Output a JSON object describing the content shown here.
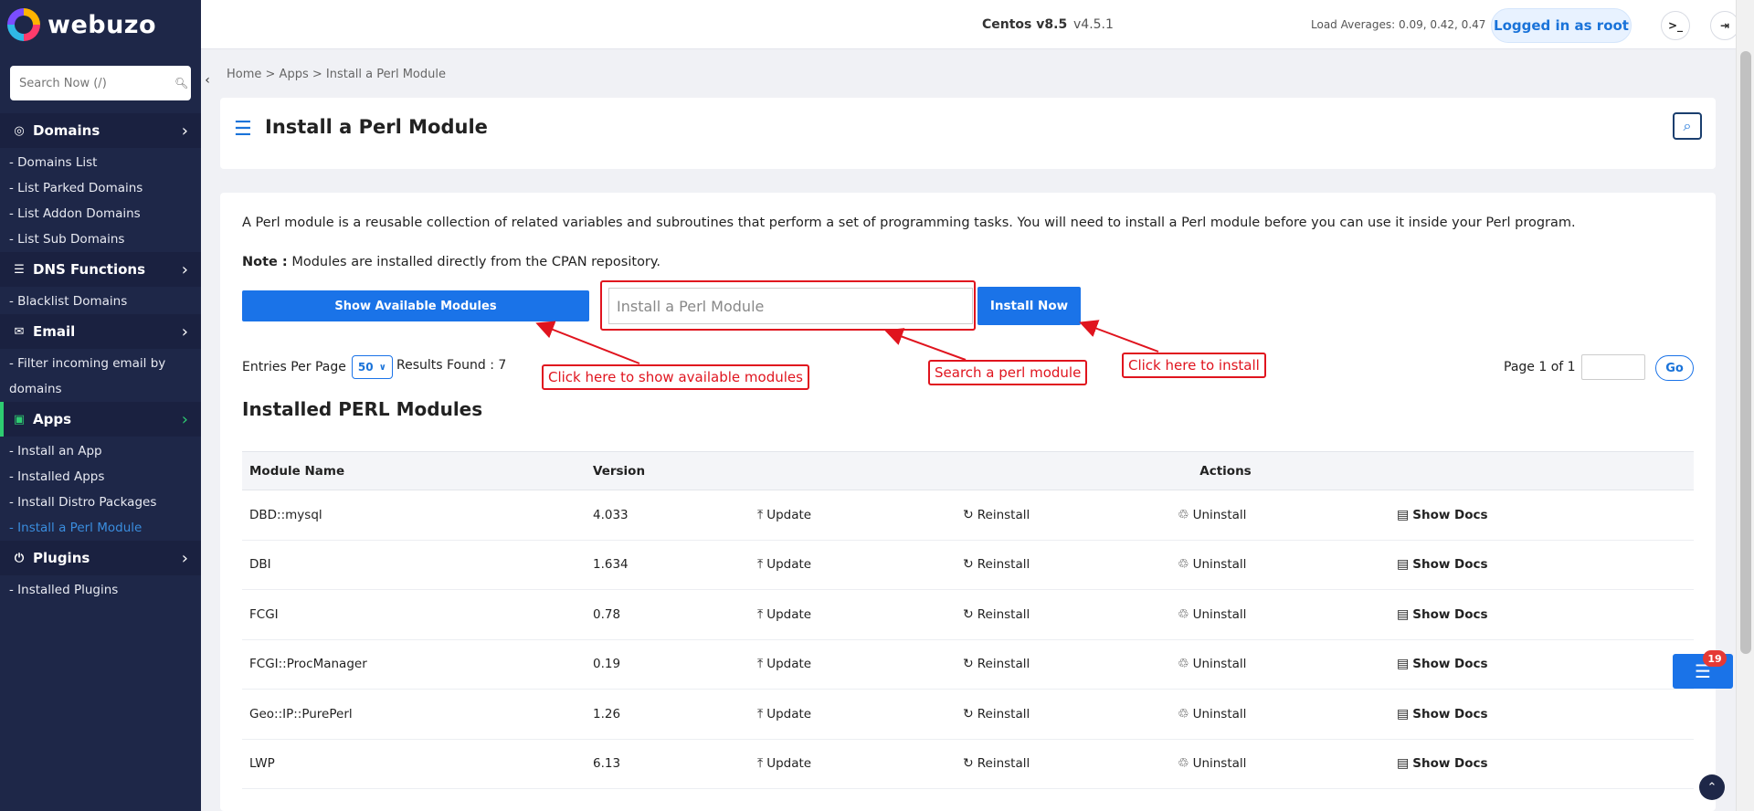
{
  "brand": {
    "name": "webuzo"
  },
  "sidebar": {
    "search_placeholder": "Search Now (/)",
    "collapse_icon": "chevron-left-icon",
    "sections": {
      "domains": {
        "title": "Domains",
        "items": [
          "- Domains List",
          "- List Parked Domains",
          "- List Addon Domains",
          "- List Sub Domains"
        ]
      },
      "dns": {
        "title": "DNS Functions",
        "items": [
          "- Blacklist Domains"
        ]
      },
      "email": {
        "title": "Email",
        "items": [
          "- Filter incoming email by",
          "domains"
        ]
      },
      "apps": {
        "title": "Apps",
        "items": [
          "- Install an App",
          "- Installed Apps",
          "- Install Distro Packages",
          "- Install a Perl Module"
        ]
      },
      "plugins": {
        "title": "Plugins",
        "items": [
          "- Installed Plugins"
        ]
      }
    }
  },
  "topbar": {
    "os_name": "Centos v8.5",
    "os_version": "v4.5.1",
    "load_averages": "Load Averages: 0.09, 0.42, 0.47",
    "logged_in_label": "Logged in as root"
  },
  "breadcrumb": "Home > Apps > Install a Perl Module",
  "page": {
    "title": "Install a Perl Module",
    "description": "A Perl module is a reusable collection of related variables and subroutines that perform a set of programming tasks. You will need to install a Perl module before you can use it inside your Perl program.",
    "note_label": "Note :",
    "note_text": " Modules are installed directly from the CPAN repository.",
    "show_modules_label": "Show Available Modules",
    "perl_input_placeholder": "Install a Perl Module",
    "install_now_label": "Install Now",
    "entries_label": "Entries Per Page",
    "entries_value": "50",
    "results_found": "Results Found : 7",
    "page_of": "Page 1 of 1",
    "go_label": "Go",
    "installed_title": "Installed PERL Modules"
  },
  "table": {
    "headers": {
      "name": "Module Name",
      "version": "Version",
      "actions": "Actions"
    },
    "action_labels": {
      "update": "Update",
      "reinstall": "Reinstall",
      "uninstall": "Uninstall",
      "docs": "Show Docs"
    },
    "rows": [
      {
        "name": "DBD::mysql",
        "version": "4.033"
      },
      {
        "name": "DBI",
        "version": "1.634"
      },
      {
        "name": "FCGI",
        "version": "0.78"
      },
      {
        "name": "FCGI::ProcManager",
        "version": "0.19"
      },
      {
        "name": "Geo::IP::PurePerl",
        "version": "1.26"
      },
      {
        "name": "LWP",
        "version": "6.13"
      }
    ]
  },
  "annotations": {
    "show_modules": "Click here to show available modules",
    "search_module": "Search a perl module",
    "install": "Click here to install"
  },
  "floating": {
    "badge_count": "19"
  },
  "colors": {
    "sidebar_bg": "#1e2748",
    "primary": "#1a73e8",
    "annotation": "#e0141e",
    "active_link": "#3a8dde"
  }
}
